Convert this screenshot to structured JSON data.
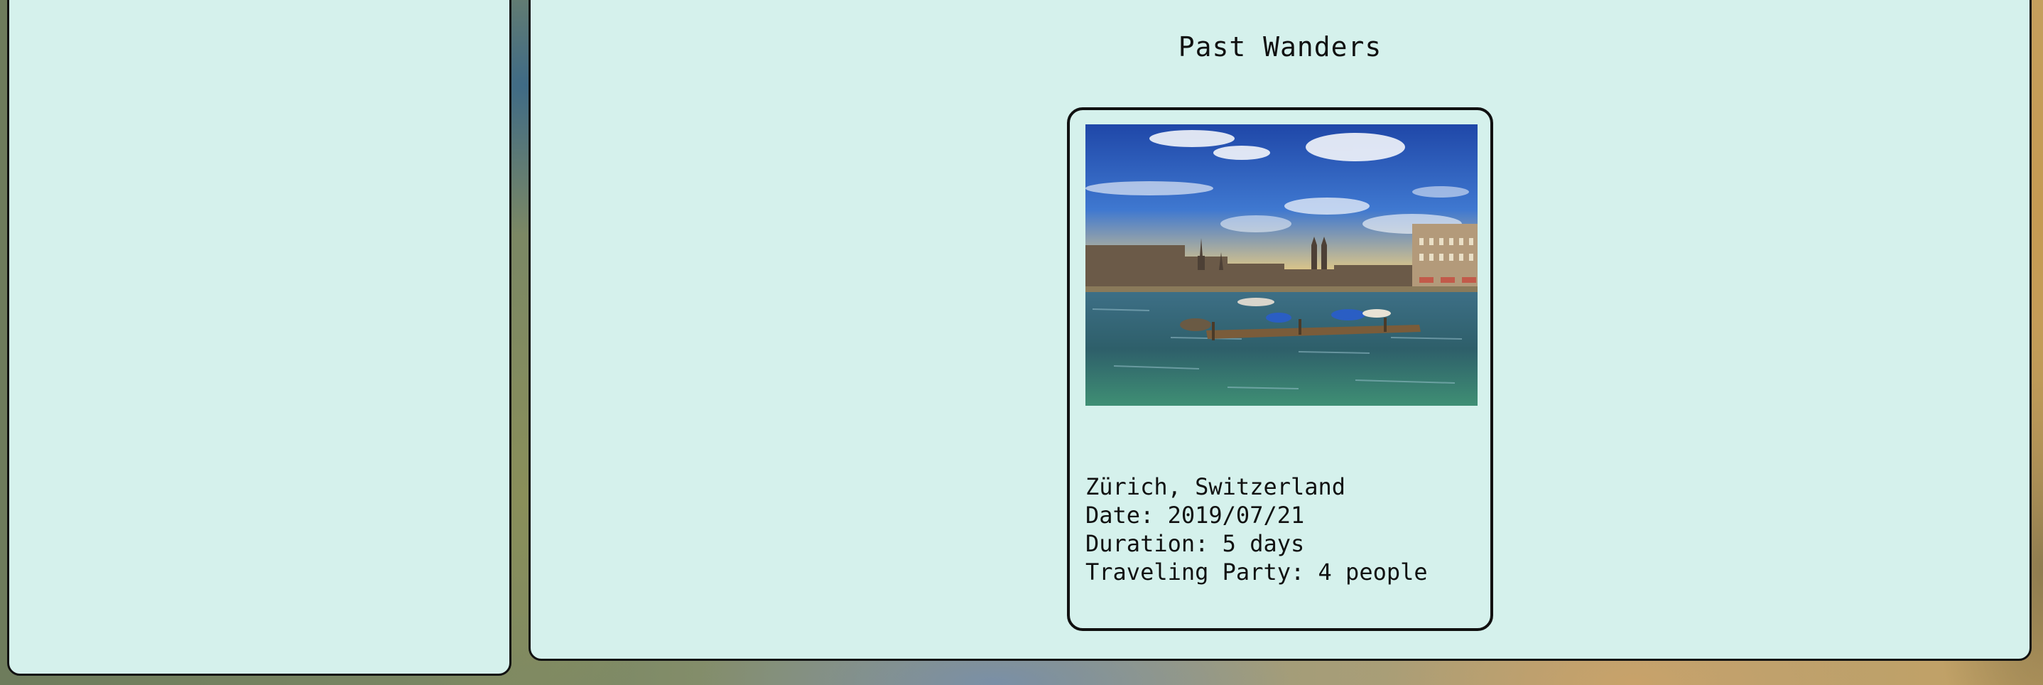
{
  "page": {
    "title": "Past Wanders"
  },
  "trips": [
    {
      "location": "Zürich, Switzerland",
      "date": "Date: 2019/07/21",
      "duration": "Duration: 5 days",
      "party": "Traveling Party: 4 people",
      "photo_alt": "Zürich, Switzerland"
    }
  ],
  "colors": {
    "panel_bg": "#d5f1ec",
    "border": "#111111",
    "text": "#111111"
  }
}
